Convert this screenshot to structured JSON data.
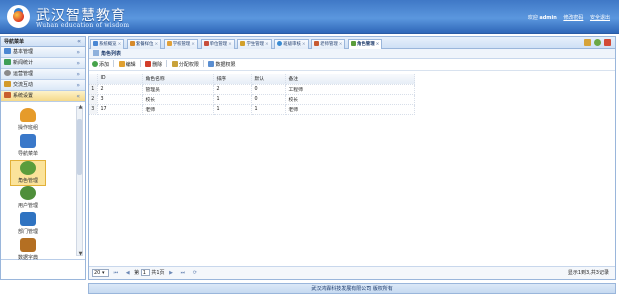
{
  "header": {
    "title": "武汉智慧教育",
    "subtitle": "Wuhan education of wisdom",
    "welcome": "欢迎",
    "username": "admin",
    "change_password": "修改密码",
    "logout": "安全退出"
  },
  "sidebar": {
    "title": "导航菜单",
    "collapse": "«",
    "groups": [
      {
        "label": "基本管理",
        "chevron": "»",
        "color": "#4a87d3"
      },
      {
        "label": "新闻统计",
        "chevron": "»",
        "color": "#3f9f56"
      },
      {
        "label": "运营管理",
        "chevron": "»",
        "color": "#8a8a8a"
      },
      {
        "label": "交流互动",
        "chevron": "»",
        "color": "#d39a2b"
      },
      {
        "label": "系统设置",
        "chevron": "«",
        "color": "#c85e2e"
      }
    ],
    "items": [
      {
        "label": "操作班组",
        "icon": "database-icon",
        "color": "#e69b2a"
      },
      {
        "label": "导航菜单",
        "icon": "sitemap-icon",
        "color": "#3a78c9"
      },
      {
        "label": "角色管理",
        "icon": "users-icon",
        "color": "#5b9d3c"
      },
      {
        "label": "用户管理",
        "icon": "user-group-icon",
        "color": "#4f8f3a"
      },
      {
        "label": "部门管理",
        "icon": "department-icon",
        "color": "#2f73c1"
      },
      {
        "label": "数据字典",
        "icon": "book-icon",
        "color": "#b46f22"
      }
    ]
  },
  "tabs": [
    {
      "label": "系统概览",
      "color": "#4a87d3",
      "active": false
    },
    {
      "label": "套餐样位",
      "color": "#d68a2b",
      "active": false
    },
    {
      "label": "学校管理",
      "color": "#e0a038",
      "active": false
    },
    {
      "label": "单位管理",
      "color": "#c84e3b",
      "active": false
    },
    {
      "label": "学生管理",
      "color": "#d2a02b",
      "active": false
    },
    {
      "label": "班级审核",
      "color": "#3a8bd2",
      "active": false
    },
    {
      "label": "老师管理",
      "color": "#c75b33",
      "active": false
    },
    {
      "label": "角色管理",
      "color": "#5b9d3c",
      "active": true
    }
  ],
  "tab_close": "×",
  "panel_title": "角色列表",
  "toolbar": {
    "add": "添加",
    "edit": "编辑",
    "delete": "删除",
    "assign": "分配权限",
    "data": "数据权限"
  },
  "table": {
    "headers": [
      "ID",
      "角色名称",
      "排序",
      "默认",
      "备注"
    ],
    "rows": [
      {
        "rn": "1",
        "id": "2",
        "name": "管理员",
        "order": "2",
        "default": "0",
        "note": "工程师"
      },
      {
        "rn": "2",
        "id": "3",
        "name": "校长",
        "order": "1",
        "default": "0",
        "note": "校长"
      },
      {
        "rn": "3",
        "id": "17",
        "name": "老师",
        "order": "1",
        "default": "1",
        "note": "老师"
      }
    ]
  },
  "pager": {
    "page_size": "20",
    "page_label": "第",
    "page": "1",
    "total_pages": "共1页",
    "info": "显示1到3,共3记录"
  },
  "footer": "武汉鸿霖科技发展有限公司 版权所有"
}
